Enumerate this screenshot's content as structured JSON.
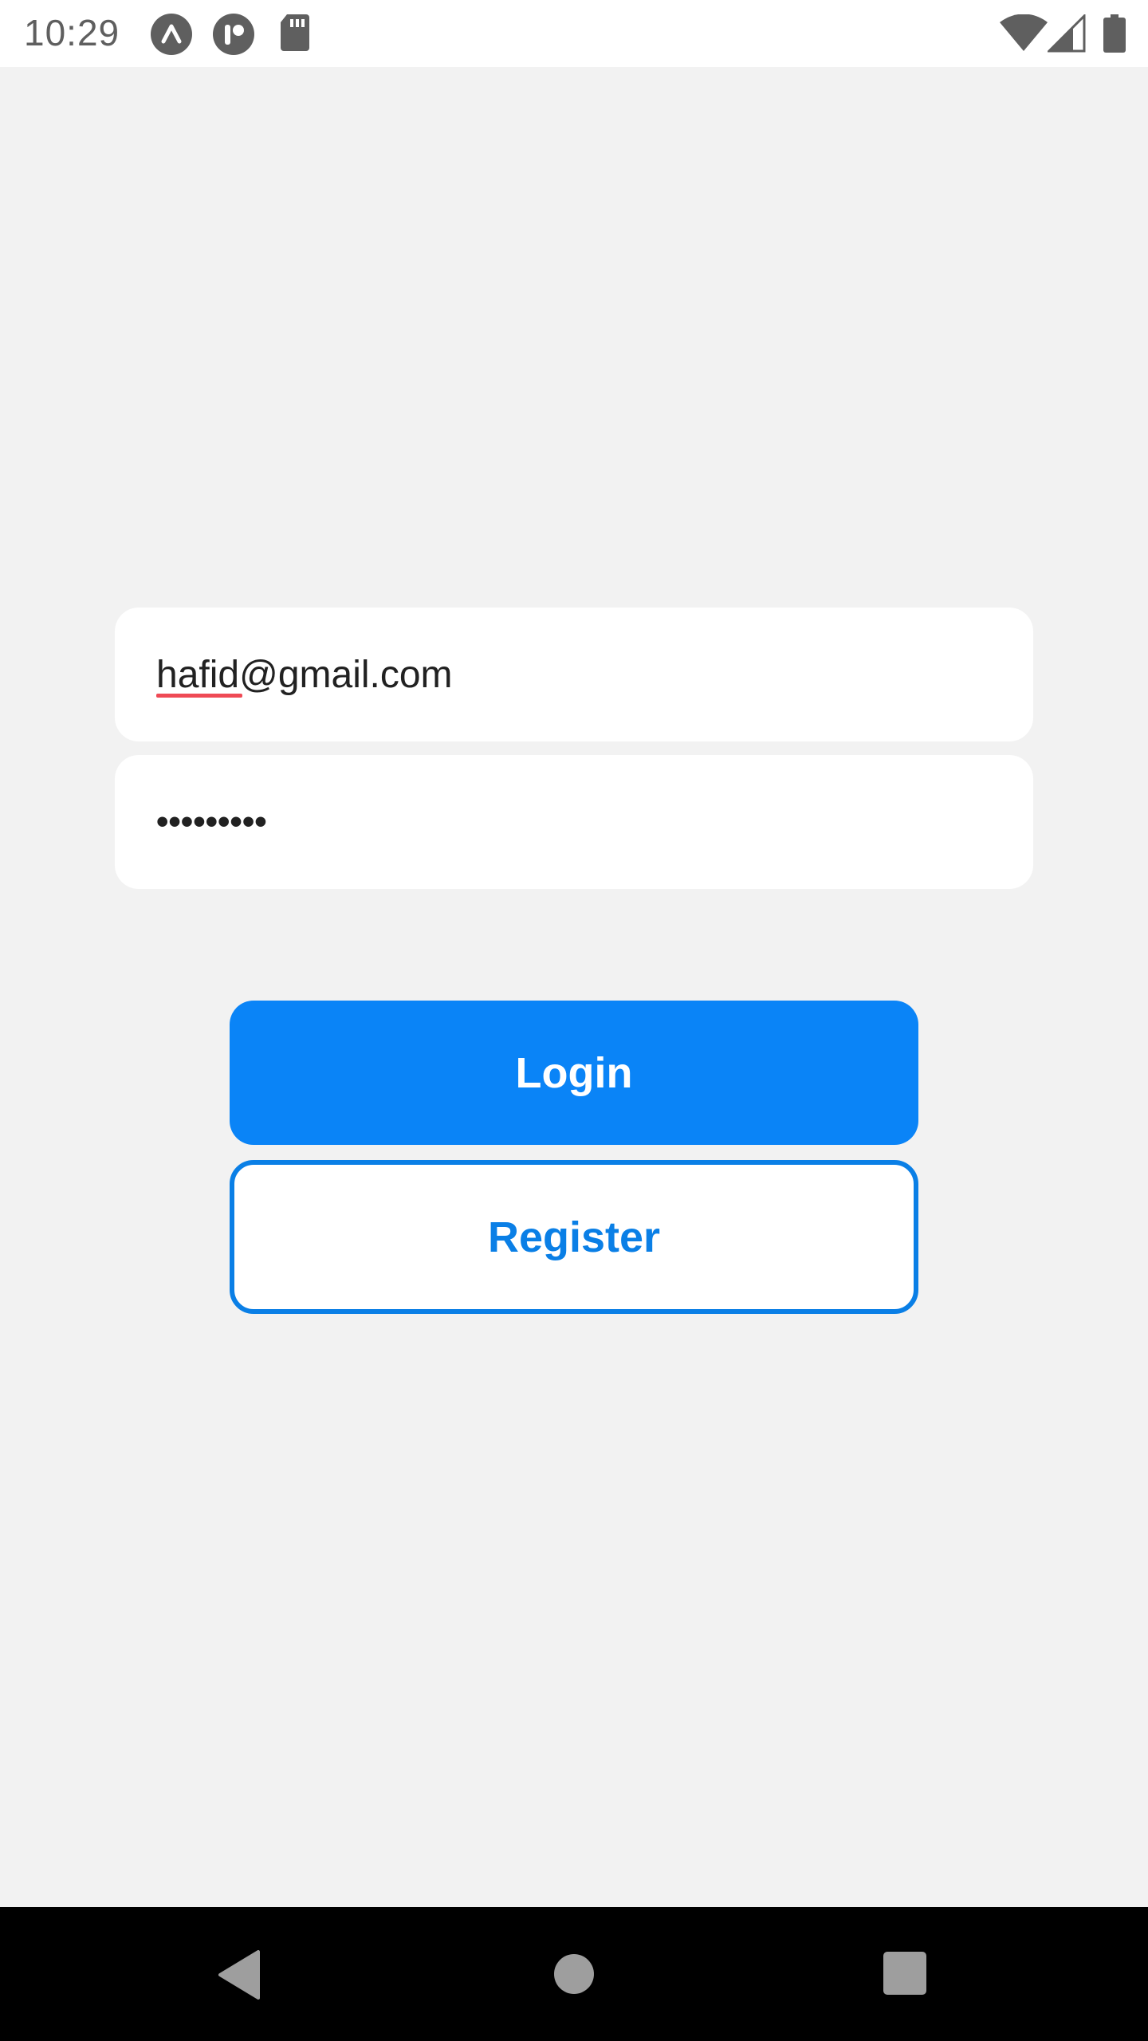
{
  "status_bar": {
    "time": "10:29",
    "left_icons": [
      "expo-icon",
      "notification-app-icon",
      "sd-card-icon"
    ],
    "right_icons": [
      "wifi-icon",
      "cell-signal-icon",
      "battery-icon"
    ]
  },
  "login_form": {
    "email_value": "hafid@gmail.com",
    "password_mask": "•••••••••",
    "login_label": "Login",
    "register_label": "Register"
  },
  "colors": {
    "primary": "#0a84f7",
    "register_border": "#0a7fe6",
    "background": "#f2f2f2",
    "spellcheck_underline": "#ef4a55"
  },
  "nav_bar": {
    "icons": [
      "back-icon",
      "home-icon",
      "recents-icon"
    ]
  }
}
